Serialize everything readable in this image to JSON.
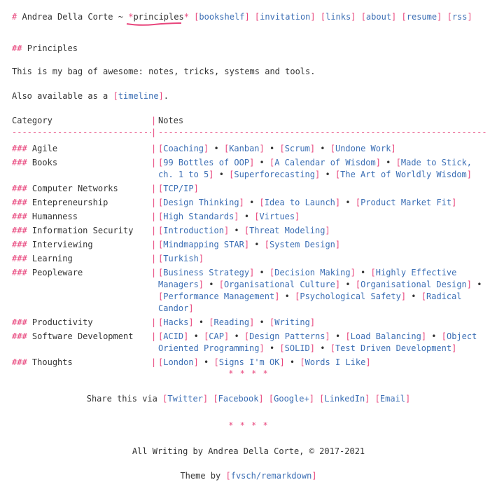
{
  "header": {
    "prefix": "#",
    "author": "Andrea Della Corte",
    "tilde": "~",
    "active": "principles",
    "nav": [
      "bookshelf",
      "invitation",
      "links",
      "about",
      "resume",
      "rss"
    ]
  },
  "heading": {
    "marker": "##",
    "text": "Principles"
  },
  "intro": "This is my bag of awesome: notes, tricks, systems and tools.",
  "also": {
    "before": "Also available as a",
    "link": "timeline",
    "after": "."
  },
  "table": {
    "col1": "Category",
    "col2": "Notes",
    "dashes1": "----------------------------",
    "dashes2": "-----------------------------------------------------------------",
    "rows": [
      {
        "cat": "Agile",
        "notes": [
          "Coaching",
          "Kanban",
          "Scrum",
          "Undone Work"
        ]
      },
      {
        "cat": "Books",
        "notes": [
          "99 Bottles of OOP",
          "A Calendar of Wisdom",
          "Made to Stick, ch. 1 to 5",
          "Superforecasting",
          "The Art of Worldly Wisdom"
        ]
      },
      {
        "cat": "Computer Networks",
        "notes": [
          "TCP/IP"
        ]
      },
      {
        "cat": "Entepreneurship",
        "notes": [
          "Design Thinking",
          "Idea to Launch",
          "Product Market Fit"
        ]
      },
      {
        "cat": "Humanness",
        "notes": [
          "High Standards",
          "Virtues"
        ]
      },
      {
        "cat": "Information Security",
        "notes": [
          "Introduction",
          "Threat Modeling"
        ]
      },
      {
        "cat": "Interviewing",
        "notes": [
          "Mindmapping STAR",
          "System Design"
        ]
      },
      {
        "cat": "Learning",
        "notes": [
          "Turkish"
        ]
      },
      {
        "cat": "Peopleware",
        "notes": [
          "Business Strategy",
          "Decision Making",
          "Highly Effective Managers",
          "Organisational Culture",
          "Organisational Design",
          "Performance Management",
          "Psychological Safety",
          "Radical Candor"
        ]
      },
      {
        "cat": "Productivity",
        "notes": [
          "Hacks",
          "Reading",
          "Writing"
        ]
      },
      {
        "cat": "Software Development",
        "notes": [
          "ACID",
          "CAP",
          "Design Patterns",
          "Load Balancing",
          "Object Oriented Programming",
          "SOLID",
          "Test Driven Development"
        ]
      },
      {
        "cat": "Thoughts",
        "notes": [
          "London",
          "Signs I'm OK",
          "Words I Like"
        ]
      }
    ]
  },
  "stars": "* * * *",
  "share": {
    "label": "Share this via",
    "links": [
      "Twitter",
      "Facebook",
      "Google+",
      "LinkedIn",
      "Email"
    ]
  },
  "footer": {
    "copyright": "All Writing by Andrea Della Corte, © 2017-2021",
    "theme_label": "Theme by",
    "theme_link": "fvsch/remarkdown"
  },
  "colors": {
    "accent": "#e8457c",
    "link": "#3b6eb4",
    "text": "#333333"
  }
}
